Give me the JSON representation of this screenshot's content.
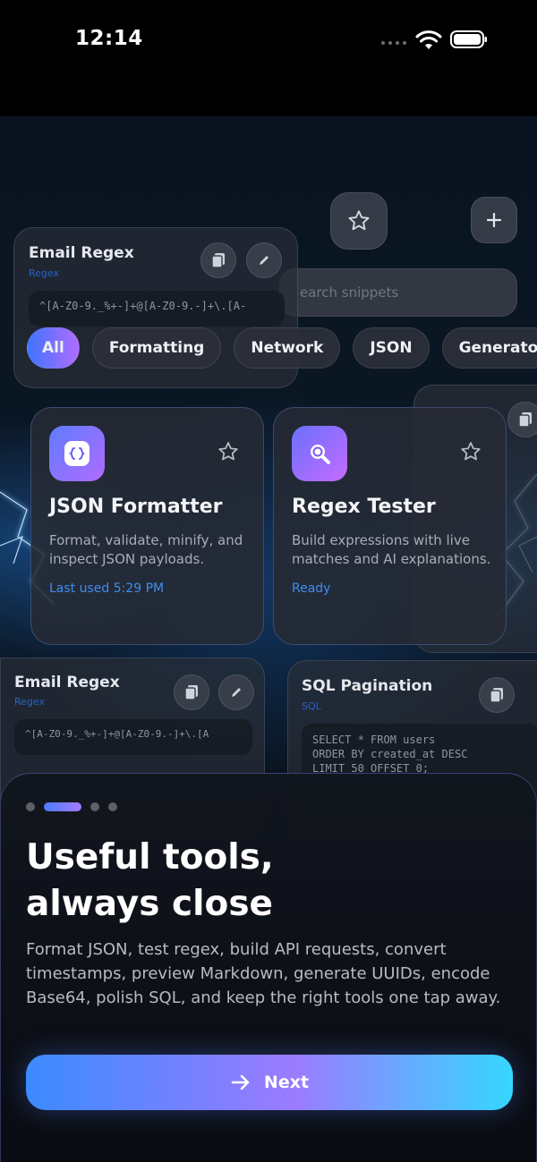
{
  "status_bar": {
    "time": "12:14"
  },
  "colors": {
    "accent_blue": "#3f8df0",
    "accent_purple": "#9b7bff",
    "accent_cyan": "#35d7ff"
  },
  "search": {
    "placeholder": "earch snippets"
  },
  "filters": [
    {
      "label": "All",
      "active": true
    },
    {
      "label": "Formatting",
      "active": false
    },
    {
      "label": "Network",
      "active": false
    },
    {
      "label": "JSON",
      "active": false
    },
    {
      "label": "Generators",
      "active": false
    }
  ],
  "snippets": {
    "top": {
      "title": "Email Regex",
      "tag": "Regex",
      "code": "^[A-Z0-9._%+-]+@[A-Z0-9.-]+\\.[A-"
    },
    "bottom_left": {
      "title": "Email Regex",
      "tag": "Regex",
      "code": "^[A-Z0-9._%+-]+@[A-Z0-9.-]+\\.[A"
    },
    "bottom_right": {
      "title": "SQL Pagination",
      "tag": "SQL",
      "code_lines": [
        "SELECT * FROM users",
        "ORDER BY created_at DESC",
        "LIMIT 50 OFFSET 0;"
      ]
    }
  },
  "tools": [
    {
      "title": "JSON Formatter",
      "description": "Format, validate, minify, and inspect JSON payloads.",
      "status": "Last used 5:29 PM",
      "icon": "braces-icon"
    },
    {
      "title": "Regex Tester",
      "description": "Build expressions with live matches and AI explanations.",
      "status": "Ready",
      "icon": "magnifier-icon"
    }
  ],
  "onboarding": {
    "headline_line1": "Useful tools,",
    "headline_line2": "always close",
    "body": "Format JSON, test regex, build API requests, convert timestamps, preview Markdown, generate UUIDs, encode Base64, polish SQL, and keep the right tools one tap away.",
    "next_label": "Next",
    "page_index": 2,
    "page_count": 4
  }
}
